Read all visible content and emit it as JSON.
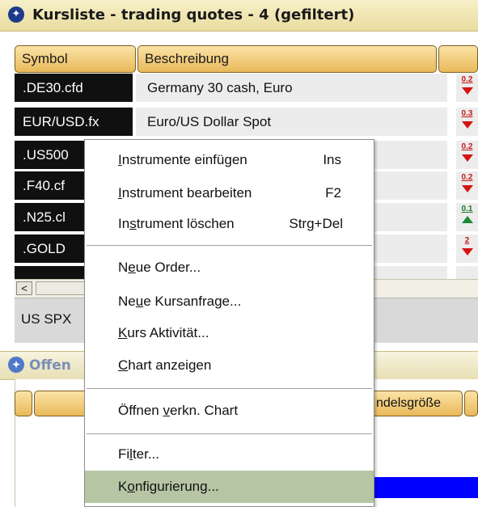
{
  "window": {
    "title": "Kursliste - trading quotes - 4 (gefiltert)",
    "icon": "app-logo-icon"
  },
  "columns": [
    "Symbol",
    "Beschreibung"
  ],
  "rows": [
    {
      "symbol": ".DE30.cfd",
      "description": "Germany 30 cash, Euro",
      "change": "0.2",
      "trend": "down"
    },
    {
      "symbol": "EUR/USD.fx",
      "description": "Euro/US Dollar Spot",
      "change": "0.3",
      "trend": "down"
    },
    {
      "symbol": ".US500",
      "description": "",
      "change": "0.2",
      "trend": "down"
    },
    {
      "symbol": ".F40.cf",
      "description": "",
      "change": "0.2",
      "trend": "down"
    },
    {
      "symbol": ".N25.cl",
      "description": "",
      "change": "0.1",
      "trend": "up"
    },
    {
      "symbol": ".GOLD",
      "description": "",
      "change": "2",
      "trend": "down"
    }
  ],
  "scroll_left": "<",
  "status_text": "US SPX",
  "window2": {
    "title": "Offen",
    "column_partial": "ndelsgröße"
  },
  "menu": {
    "items": [
      {
        "pre": "",
        "u": "I",
        "post": "nstrumente einfügen",
        "shortcut": "Ins"
      },
      {
        "pre": "",
        "u": "I",
        "post": "nstrument bearbeiten",
        "shortcut": "F2"
      },
      {
        "pre": "In",
        "u": "s",
        "post": "trument löschen",
        "shortcut": "Strg+Del"
      },
      {
        "pre": "N",
        "u": "e",
        "post": "ue Order...",
        "shortcut": ""
      },
      {
        "pre": "Ne",
        "u": "u",
        "post": "e Kursanfrage...",
        "shortcut": ""
      },
      {
        "pre": "",
        "u": "K",
        "post": "urs Aktivität...",
        "shortcut": ""
      },
      {
        "pre": "",
        "u": "C",
        "post": "hart anzeigen",
        "shortcut": ""
      },
      {
        "pre": "Öffnen ",
        "u": "v",
        "post": "erkn. Chart",
        "shortcut": ""
      },
      {
        "pre": "Fi",
        "u": "l",
        "post": "ter...",
        "shortcut": ""
      },
      {
        "pre": "K",
        "u": "o",
        "post": "nfigurierung...",
        "shortcut": ""
      }
    ]
  },
  "colors": {
    "selected_menu": "#b6c6a5",
    "trend_down": "#d41414",
    "trend_up": "#1b8a33",
    "accent_bar": "#0000ff"
  }
}
